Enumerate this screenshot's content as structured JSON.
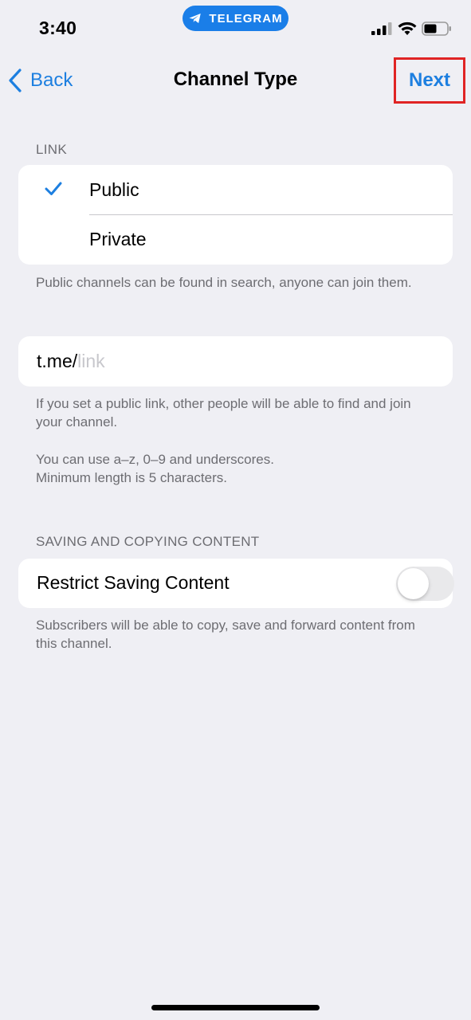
{
  "status_bar": {
    "time": "3:40",
    "app_pill": "TELEGRAM",
    "icons": [
      "signal-icon",
      "wifi-icon",
      "battery-icon"
    ]
  },
  "nav": {
    "back_label": "Back",
    "title": "Channel Type",
    "next_label": "Next"
  },
  "link_section": {
    "header": "LINK",
    "options": [
      {
        "label": "Public",
        "selected": true
      },
      {
        "label": "Private",
        "selected": false
      }
    ],
    "footnote": "Public channels can be found in search, anyone can join them."
  },
  "link_field": {
    "prefix": "t.me/",
    "value": "",
    "placeholder": "link"
  },
  "link_hints": {
    "hint1": "If you set a public link, other people will be able to find and join your channel.",
    "hint2_line1": "You can use a–z, 0–9 and underscores.",
    "hint2_line2": "Minimum length is 5 characters."
  },
  "saving_section": {
    "header": "SAVING AND COPYING CONTENT",
    "toggle_label": "Restrict Saving Content",
    "toggle_on": false,
    "footnote": "Subscribers will be able to copy, save and forward content from this channel."
  },
  "colors": {
    "accent": "#1d7fe0",
    "highlight_box": "#e02424",
    "background": "#efeff4"
  }
}
